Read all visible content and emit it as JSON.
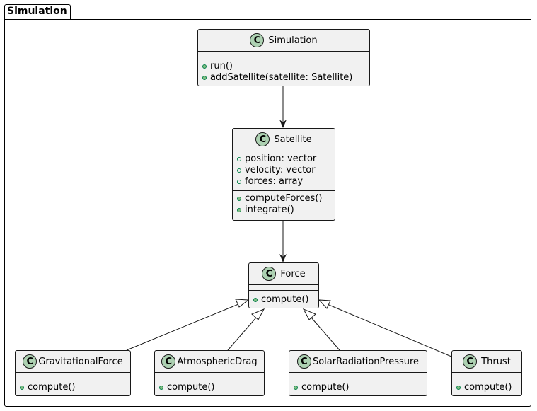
{
  "package": {
    "name": "Simulation"
  },
  "classes": [
    {
      "id": "simulation",
      "name": "Simulation",
      "icon": "C",
      "fields": [],
      "methods": [
        "run()",
        "addSatellite(satellite: Satellite)"
      ]
    },
    {
      "id": "satellite",
      "name": "Satellite",
      "icon": "C",
      "fields": [
        "position: vector",
        "velocity: vector",
        "forces: array"
      ],
      "methods": [
        "computeForces()",
        "integrate()"
      ]
    },
    {
      "id": "force",
      "name": "Force",
      "icon": "C",
      "fields": [],
      "methods": [
        "compute()"
      ]
    },
    {
      "id": "gravitational-force",
      "name": "GravitationalForce",
      "icon": "C",
      "fields": [],
      "methods": [
        "compute()"
      ]
    },
    {
      "id": "atmospheric-drag",
      "name": "AtmosphericDrag",
      "icon": "C",
      "fields": [],
      "methods": [
        "compute()"
      ]
    },
    {
      "id": "solar-radiation-pressure",
      "name": "SolarRadiationPressure",
      "icon": "C",
      "fields": [],
      "methods": [
        "compute()"
      ]
    },
    {
      "id": "thrust",
      "name": "Thrust",
      "icon": "C",
      "fields": [],
      "methods": [
        "compute()"
      ]
    }
  ],
  "relations": [
    {
      "from": "simulation",
      "to": "satellite",
      "type": "association"
    },
    {
      "from": "satellite",
      "to": "force",
      "type": "association"
    },
    {
      "from": "gravitational-force",
      "to": "force",
      "type": "inheritance"
    },
    {
      "from": "atmospheric-drag",
      "to": "force",
      "type": "inheritance"
    },
    {
      "from": "solar-radiation-pressure",
      "to": "force",
      "type": "inheritance"
    },
    {
      "from": "thrust",
      "to": "force",
      "type": "inheritance"
    }
  ],
  "colors": {
    "class_bg": "#f1f1f1",
    "class_icon": "#add1b2",
    "border": "#181818",
    "visibility": "#84be84"
  }
}
